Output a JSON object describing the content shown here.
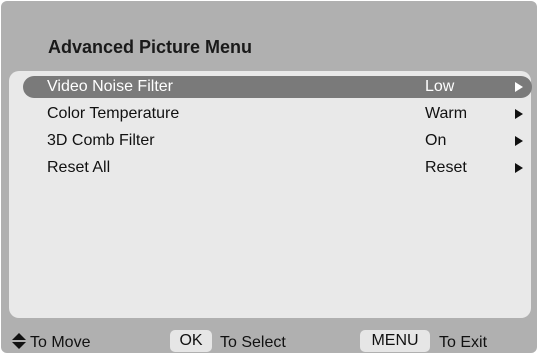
{
  "menu": {
    "title": "Advanced Picture Menu",
    "items": [
      {
        "label": "Video Noise Filter",
        "value": "Low",
        "selected": true,
        "arrow_icon": "right-triangle-icon"
      },
      {
        "label": "Color Temperature",
        "value": "Warm",
        "selected": false,
        "arrow_icon": "right-triangle-icon"
      },
      {
        "label": "3D Comb Filter",
        "value": "On",
        "selected": false,
        "arrow_icon": "right-triangle-icon"
      },
      {
        "label": "Reset All",
        "value": "Reset",
        "selected": false,
        "arrow_icon": "right-triangle-icon"
      }
    ]
  },
  "footer": {
    "move_icon": "up-down-arrows-icon",
    "move_label": "To Move",
    "ok_key": "OK",
    "select_label": "To Select",
    "menu_key": "MENU",
    "exit_label": "To Exit"
  },
  "colors": {
    "frame_bg": "#b0b0b0",
    "panel_bg": "#e9e9e9",
    "selected_bg": "#7a7a7a",
    "selected_text": "#ffffff",
    "text": "#111111"
  }
}
